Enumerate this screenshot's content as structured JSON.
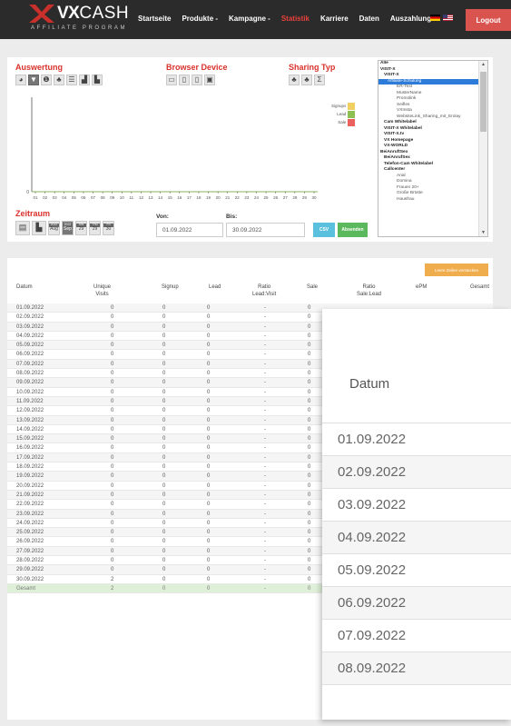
{
  "brand": {
    "vx": "VX",
    "cash": "CASH",
    "sub": "AFFILIATE PROGRAM"
  },
  "nav": {
    "items": [
      "Startseite",
      "Produkte -",
      "Kampagne -",
      "Statistik",
      "Karriere",
      "Daten",
      "Auszahlung"
    ],
    "active": "Statistik",
    "logout": "Logout"
  },
  "colors": {
    "accent": "#d9312c",
    "signup": "#f0d060",
    "lead": "#8cc152",
    "sale": "#e8615c"
  },
  "auswertung": {
    "title": "Auswertung"
  },
  "browser": {
    "title": "Browser Device"
  },
  "sharing": {
    "title": "Sharing Typ",
    "sum_symbol": "Σ"
  },
  "chart": {
    "x_ticks": [
      "01",
      "02",
      "03",
      "04",
      "05",
      "06",
      "07",
      "08",
      "09",
      "10",
      "11",
      "12",
      "13",
      "14",
      "15",
      "16",
      "17",
      "18",
      "19",
      "20",
      "21",
      "22",
      "23",
      "24",
      "25",
      "26",
      "27",
      "28",
      "29",
      "30"
    ],
    "y_tick": "0"
  },
  "legend": [
    "Signups",
    "Lead",
    "Sale"
  ],
  "listbox": [
    {
      "label": "Alle",
      "cls": "b"
    },
    {
      "label": "VISIT-X",
      "cls": "b"
    },
    {
      "label": "VISIT-X",
      "cls": "b i1"
    },
    {
      "label": "Affiliate-Schulung",
      "cls": "i2 sel"
    },
    {
      "label": "ER-Test",
      "cls": "i3"
    },
    {
      "label": "MusterName",
      "cls": "i3"
    },
    {
      "label": "Promolink",
      "cls": "i3"
    },
    {
      "label": "Seifles",
      "cls": "i3"
    },
    {
      "label": "VXInsta",
      "cls": "i3"
    },
    {
      "label": "WebsiteLink_Sharing_mit_Erolay",
      "cls": "i3"
    },
    {
      "label": "Cam Whitelabel",
      "cls": "b i1"
    },
    {
      "label": "VISIT-X Whitelabel",
      "cls": "b i1"
    },
    {
      "label": "VISIT-X.tv",
      "cls": "b i1"
    },
    {
      "label": "VX Homepage",
      "cls": "b i1"
    },
    {
      "label": "VX-WORLD",
      "cls": "b i1"
    },
    {
      "label": "BeiAnruftSex",
      "cls": "b"
    },
    {
      "label": "BeiAnrufSex",
      "cls": "b i1"
    },
    {
      "label": "Telefon-Cam Whitelabel",
      "cls": "b i1"
    },
    {
      "label": "Callcenter",
      "cls": "b i1"
    },
    {
      "label": "Anal",
      "cls": "i3"
    },
    {
      "label": "Domina",
      "cls": "i3"
    },
    {
      "label": "Frauen 20+",
      "cls": "i3"
    },
    {
      "label": "Große Brüste",
      "cls": "i3"
    },
    {
      "label": "Hausfrau",
      "cls": "i3"
    }
  ],
  "zeitraum": {
    "title": "Zeitraum",
    "btn_aug_top": "2022",
    "btn_aug": "Aug",
    "btn_sep_top": "2022",
    "btn_sep": "Sep",
    "btn_w1_top": "SW",
    "btn_w1": "29",
    "btn_w2_top": "Thu",
    "btn_w2": "29",
    "btn_w3_top": "Fri",
    "btn_w3": "30"
  },
  "form": {
    "von_label": "Von:",
    "von_value": "01.09.2022",
    "bis_label": "Bis:",
    "bis_value": "30.09.2022",
    "csv": "CSV",
    "absenden": "Absenden"
  },
  "table": {
    "hide_zero": "Leere Zeilen verstecken",
    "headers": [
      "Datum",
      "Unique\nVisits",
      "Signup",
      "Lead",
      "Ratio\nLead:Visit",
      "Sale",
      "Ratio\nSale:Lead",
      "ePM",
      "Gesamt"
    ],
    "rows": [
      [
        "01.09.2022",
        "0",
        "0",
        "0",
        "-",
        "0"
      ],
      [
        "02.09.2022",
        "0",
        "0",
        "0",
        "-",
        "0"
      ],
      [
        "03.09.2022",
        "0",
        "0",
        "0",
        "-",
        "0"
      ],
      [
        "04.09.2022",
        "0",
        "0",
        "0",
        "-",
        "0"
      ],
      [
        "05.09.2022",
        "0",
        "0",
        "0",
        "-",
        "0"
      ],
      [
        "06.09.2022",
        "0",
        "0",
        "0",
        "-",
        "0"
      ],
      [
        "07.09.2022",
        "0",
        "0",
        "0",
        "-",
        "0"
      ],
      [
        "08.09.2022",
        "0",
        "0",
        "0",
        "-",
        "0"
      ],
      [
        "09.09.2022",
        "0",
        "0",
        "0",
        "-",
        "0"
      ],
      [
        "10.09.2022",
        "0",
        "0",
        "0",
        "-",
        "0"
      ],
      [
        "11.09.2022",
        "0",
        "0",
        "0",
        "-",
        "0"
      ],
      [
        "12.09.2022",
        "0",
        "0",
        "0",
        "-",
        "0"
      ],
      [
        "13.09.2022",
        "0",
        "0",
        "0",
        "-",
        "0"
      ],
      [
        "14.09.2022",
        "0",
        "0",
        "0",
        "-",
        "0"
      ],
      [
        "15.09.2022",
        "0",
        "0",
        "0",
        "-",
        "0"
      ],
      [
        "16.09.2022",
        "0",
        "0",
        "0",
        "-",
        "0"
      ],
      [
        "17.09.2022",
        "0",
        "0",
        "0",
        "-",
        "0"
      ],
      [
        "18.09.2022",
        "0",
        "0",
        "0",
        "-",
        "0"
      ],
      [
        "19.09.2022",
        "0",
        "0",
        "0",
        "-",
        "0"
      ],
      [
        "20.09.2022",
        "0",
        "0",
        "0",
        "-",
        "0"
      ],
      [
        "21.09.2022",
        "0",
        "0",
        "0",
        "-",
        "0"
      ],
      [
        "22.09.2022",
        "0",
        "0",
        "0",
        "-",
        "0"
      ],
      [
        "23.09.2022",
        "0",
        "0",
        "0",
        "-",
        "0"
      ],
      [
        "24.09.2022",
        "0",
        "0",
        "0",
        "-",
        "0"
      ],
      [
        "25.09.2022",
        "0",
        "0",
        "0",
        "-",
        "0"
      ],
      [
        "26.09.2022",
        "0",
        "0",
        "0",
        "-",
        "0"
      ],
      [
        "27.09.2022",
        "0",
        "0",
        "0",
        "-",
        "0"
      ],
      [
        "28.09.2022",
        "0",
        "0",
        "0",
        "-",
        "0"
      ],
      [
        "29.09.2022",
        "0",
        "0",
        "0",
        "-",
        "0"
      ],
      [
        "30.09.2022",
        "2",
        "0",
        "0",
        "-",
        "0"
      ]
    ],
    "total": [
      "Gesamt",
      "2",
      "0",
      "0",
      "-",
      "0"
    ]
  },
  "zoom": {
    "header": "Datum",
    "rows": [
      "01.09.2022",
      "02.09.2022",
      "03.09.2022",
      "04.09.2022",
      "05.09.2022",
      "06.09.2022",
      "07.09.2022",
      "08.09.2022"
    ]
  }
}
